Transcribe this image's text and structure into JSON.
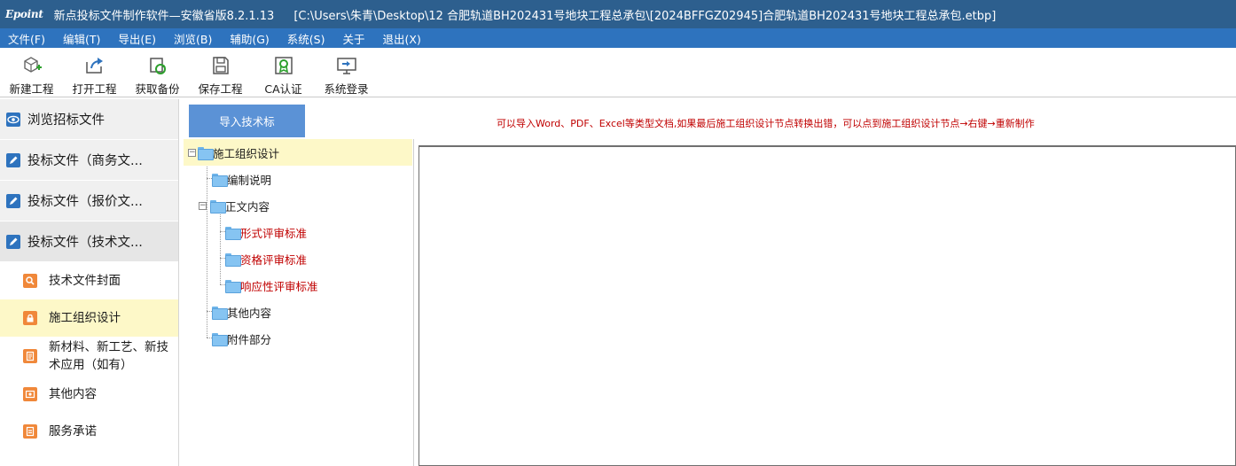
{
  "window": {
    "logo": "Epoint",
    "app_title": "新点投标文件制作软件—安徽省版8.2.1.13",
    "file_path": "[C:\\Users\\朱青\\Desktop\\12 合肥轨道BH202431号地块工程总承包\\[2024BFFGZ02945]合肥轨道BH202431号地块工程总承包.etbp]"
  },
  "menu": [
    "文件(F)",
    "编辑(T)",
    "导出(E)",
    "浏览(B)",
    "辅助(G)",
    "系统(S)",
    "关于",
    "退出(X)"
  ],
  "toolbar": [
    {
      "label": "新建工程",
      "icon": "new-project-icon"
    },
    {
      "label": "打开工程",
      "icon": "open-project-icon"
    },
    {
      "label": "获取备份",
      "icon": "get-backup-icon"
    },
    {
      "label": "保存工程",
      "icon": "save-project-icon"
    },
    {
      "label": "CA认证",
      "icon": "ca-certificate-icon"
    },
    {
      "label": "系统登录",
      "icon": "system-login-icon"
    }
  ],
  "sidebar": {
    "sections": [
      {
        "label": "浏览招标文件",
        "icon": "eye-icon"
      },
      {
        "label": "投标文件（商务文...",
        "icon": "edit-icon"
      },
      {
        "label": "投标文件（报价文...",
        "icon": "edit-icon"
      },
      {
        "label": "投标文件（技术文...",
        "icon": "edit-icon"
      }
    ],
    "sub_items": [
      {
        "label": "技术文件封面",
        "icon": "search-icon"
      },
      {
        "label": "施工组织设计",
        "icon": "lock-icon",
        "selected": true
      },
      {
        "label": "新材料、新工艺、新技术应用（如有）",
        "icon": "document-icon"
      },
      {
        "label": "其他内容",
        "icon": "image-icon"
      },
      {
        "label": "服务承诺",
        "icon": "contract-icon"
      }
    ]
  },
  "import_button": "导入技术标",
  "tree": {
    "root": "施工组织设计",
    "bianzhi": "编制说明",
    "zhengwen": "正文内容",
    "xingshi": "形式评审标准",
    "zige": "资格评审标准",
    "xiangying": "响应性评审标准",
    "qita": "其他内容",
    "fujian": "附件部分",
    "expander_symbol": "−"
  },
  "hint": "可以导入Word、PDF、Excel等类型文档,如果最后施工组织设计节点转换出错，可以点到施工组织设计节点→右键→重新制作",
  "colors": {
    "titlebar": "#2d5f8e",
    "menubar": "#2e73be",
    "import_button": "#5b92d6",
    "selected_bg": "#fdf8c8",
    "hint_text": "#c00000",
    "sub_icon": "#f0883a"
  }
}
